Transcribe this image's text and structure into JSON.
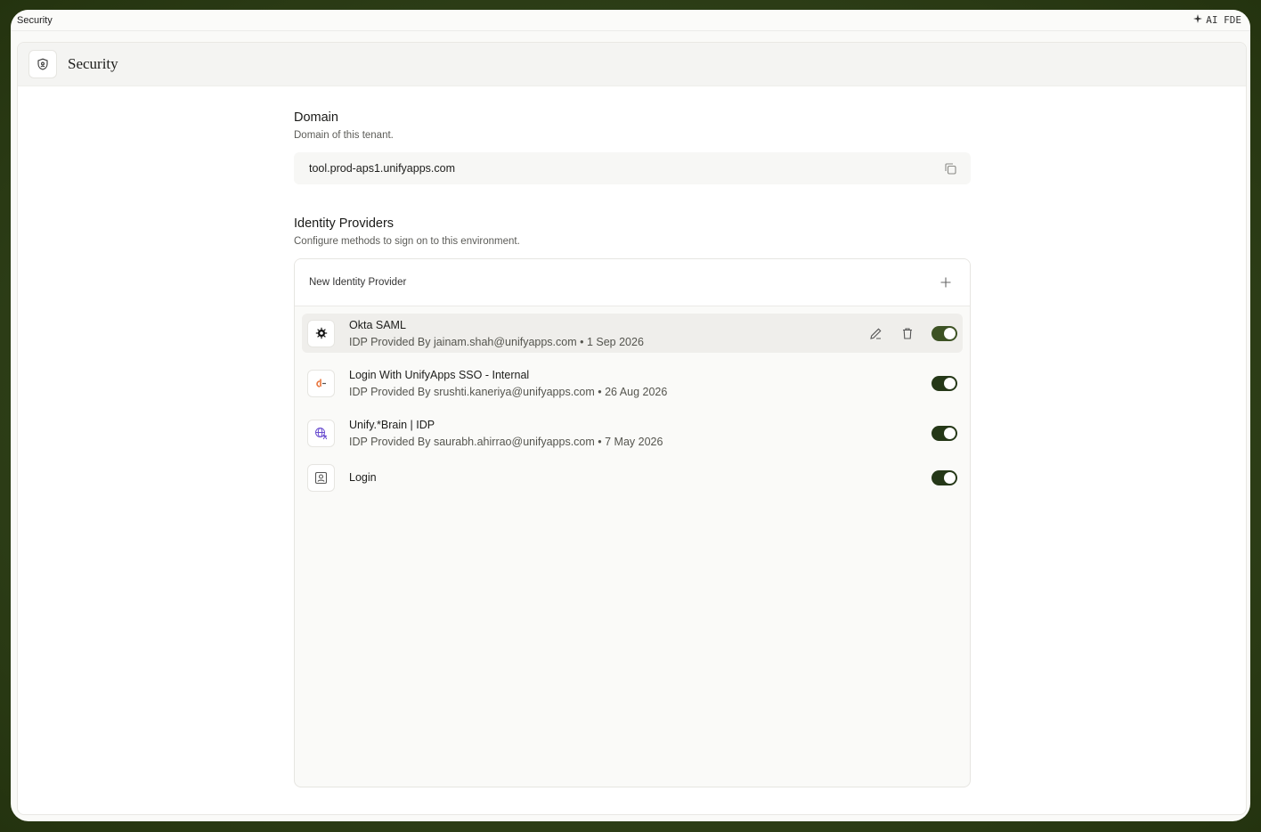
{
  "window": {
    "title": "Security",
    "ai_label": "AI FDE"
  },
  "header": {
    "title": "Security",
    "icon": "shield-icon"
  },
  "domain": {
    "title": "Domain",
    "subtitle": "Domain of this tenant.",
    "value": "tool.prod-aps1.unifyapps.com",
    "copy_icon": "copy-icon"
  },
  "identity_providers": {
    "title": "Identity Providers",
    "subtitle": "Configure methods to sign on to this environment.",
    "new_label": "New Identity Provider",
    "items": [
      {
        "name": "Okta SAML",
        "meta": "IDP Provided By jainam.shah@unifyapps.com • 1 Sep 2026",
        "icon": "okta-logo-icon",
        "enabled": true
      },
      {
        "name": "Login With UnifyApps SSO - Internal",
        "meta": "IDP Provided By srushti.kaneriya@unifyapps.com • 26 Aug 2026",
        "icon": "unifyapps-logo-icon",
        "enabled": true
      },
      {
        "name": "Unify.*Brain | IDP",
        "meta": "IDP Provided By saurabh.ahirrao@unifyapps.com • 7 May 2026",
        "icon": "globe-translate-icon",
        "enabled": true
      },
      {
        "name": "Login",
        "icon": "user-card-icon",
        "enabled": true
      }
    ]
  }
}
